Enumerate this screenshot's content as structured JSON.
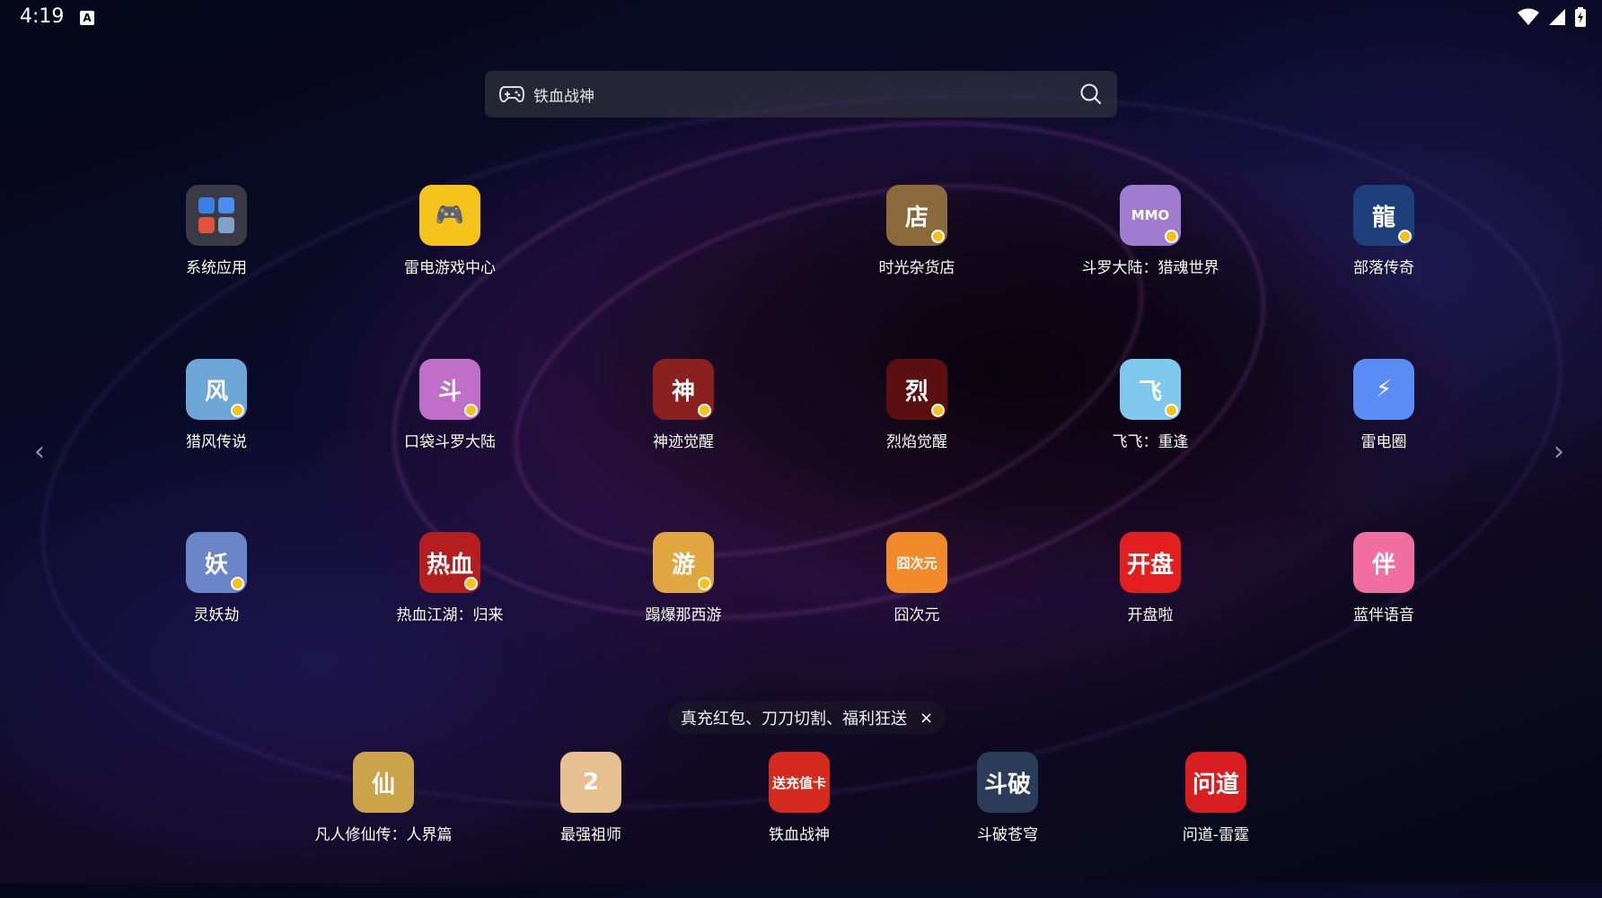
{
  "status": {
    "time": "4:19",
    "notif_glyph": "A"
  },
  "search": {
    "text": "铁血战神"
  },
  "grid": [
    {
      "label": "系统应用",
      "bg": "#3a3a44",
      "glyph": ""
    },
    {
      "label": "雷电游戏中心",
      "bg": "#f6c21c",
      "glyph": "🎮"
    },
    {
      "label": "时光杂货店",
      "bg": "#8a6a3a",
      "glyph": "店"
    },
    {
      "label": "斗罗大陆：猎魂世界",
      "bg": "#a07bd0",
      "glyph": "MMO"
    },
    {
      "label": "部落传奇",
      "bg": "#1f3f7a",
      "glyph": "龍"
    },
    {
      "label": "猎风传说",
      "bg": "#6fa6d8",
      "glyph": "风"
    },
    {
      "label": "口袋斗罗大陆",
      "bg": "#c06fc8",
      "glyph": "斗"
    },
    {
      "label": "神迹觉醒",
      "bg": "#8a2020",
      "glyph": "神"
    },
    {
      "label": "烈焰觉醒",
      "bg": "#5a1010",
      "glyph": "烈"
    },
    {
      "label": "飞飞：重逢",
      "bg": "#7fc8ee",
      "glyph": "飞"
    },
    {
      "label": "雷电圈",
      "bg": "#5b8cf5",
      "glyph": "⚡"
    },
    {
      "label": "灵妖劫",
      "bg": "#6a86c8",
      "glyph": "妖"
    },
    {
      "label": "热血江湖：归来",
      "bg": "#b41e1e",
      "glyph": "热血"
    },
    {
      "label": "蹋爆那西游",
      "bg": "#e0a640",
      "glyph": "游"
    },
    {
      "label": "囧次元",
      "bg": "#f08a2a",
      "glyph": "囧次元"
    },
    {
      "label": "开盘啦",
      "bg": "#e21e1e",
      "glyph": "开盘"
    },
    {
      "label": "蓝伴语音",
      "bg": "#f06ea0",
      "glyph": "伴"
    }
  ],
  "banner": {
    "text": "真充红包、刀刀切割、福利狂送",
    "close": "×"
  },
  "dock": [
    {
      "label": "凡人修仙传：人界篇",
      "bg": "#caa34a",
      "glyph": "仙"
    },
    {
      "label": "最强祖师",
      "bg": "#e6c090",
      "glyph": "2"
    },
    {
      "label": "铁血战神",
      "bg": "#d62a20",
      "glyph": "送充值卡"
    },
    {
      "label": "斗破苍穹",
      "bg": "#2b3b5a",
      "glyph": "斗破"
    },
    {
      "label": "问道-雷霆",
      "bg": "#d81e20",
      "glyph": "问道"
    }
  ],
  "icons": {
    "wifi": "wifi-icon",
    "signal": "signal-icon",
    "battery": "battery-icon",
    "gamepad": "gamepad-icon",
    "search": "search-icon"
  },
  "colors": {
    "badge": "#f4c21a",
    "search_bg": "#3c3c46"
  }
}
